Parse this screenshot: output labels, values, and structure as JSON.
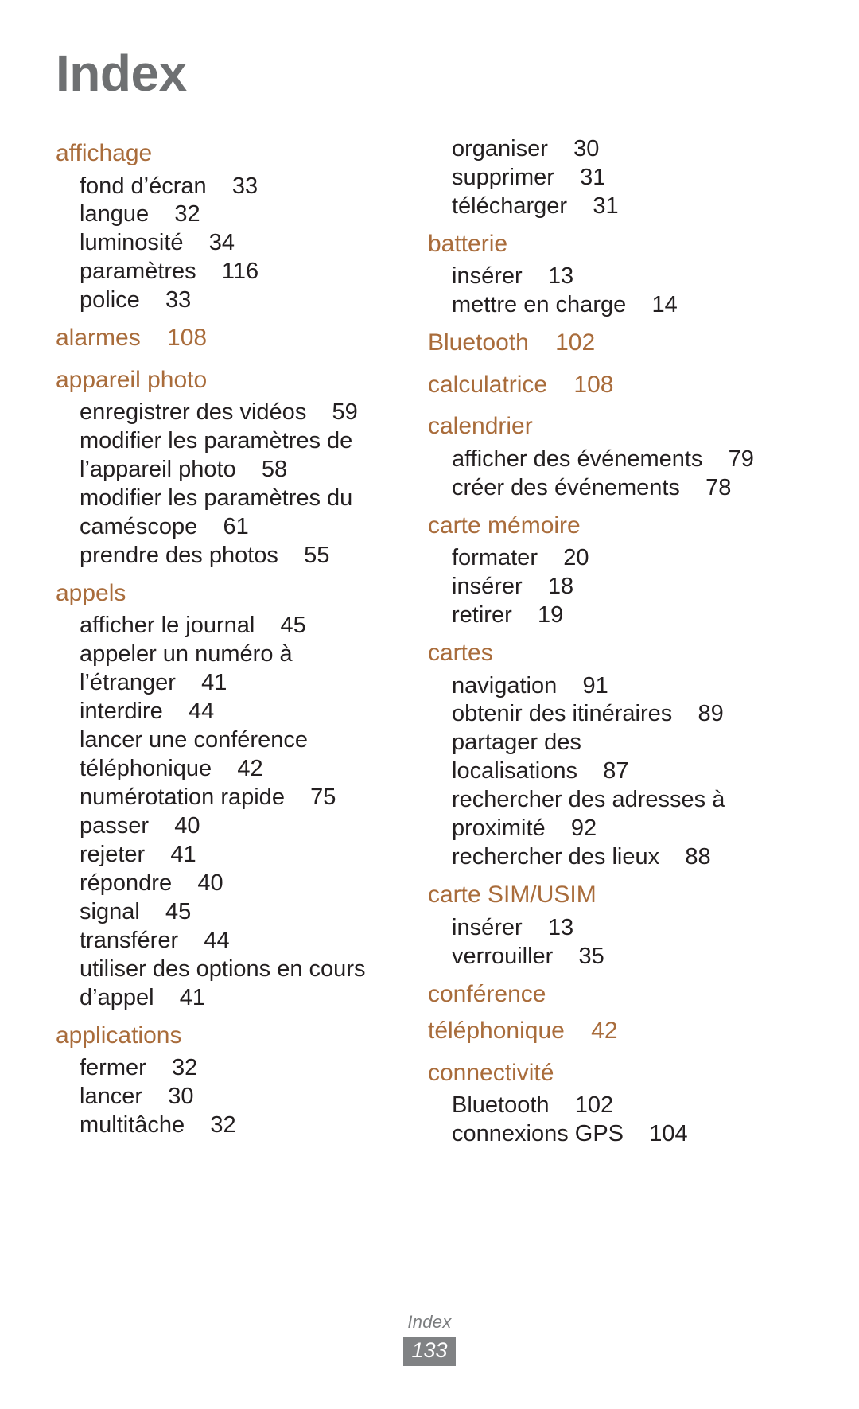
{
  "page_title": "Index",
  "footer": {
    "label": "Index",
    "page_number": "133"
  },
  "colors": {
    "heading": "#a96c3b",
    "entry": "#231f20",
    "title": "#6e7072",
    "footer_box": "#808284"
  },
  "columns": [
    {
      "groups": [
        {
          "heading": "affichage",
          "heading_page": "",
          "entries": [
            "fond d’écran    33",
            "langue    32",
            "luminosité    34",
            "paramètres    116",
            "police    33"
          ]
        },
        {
          "heading": "alarmes",
          "heading_page": "108",
          "entries": []
        },
        {
          "heading": "appareil photo",
          "heading_page": "",
          "entries": [
            "enregistrer des vidéos    59",
            "modifier les paramètres de\nl’appareil photo    58",
            "modifier les paramètres du\ncaméscope    61",
            "prendre des photos    55"
          ]
        },
        {
          "heading": "appels",
          "heading_page": "",
          "entries": [
            "afficher le journal    45",
            "appeler un numéro à\nl’étranger    41",
            "interdire    44",
            "lancer une conférence\ntéléphonique    42",
            "numérotation rapide    75",
            "passer    40",
            "rejeter    41",
            "répondre    40",
            "signal    45",
            "transférer    44",
            "utiliser des options en cours\nd’appel    41"
          ]
        },
        {
          "heading": "applications",
          "heading_page": "",
          "entries": [
            "fermer    32",
            "lancer    30",
            "multitâche    32"
          ]
        }
      ]
    },
    {
      "groups": [
        {
          "heading": "",
          "heading_page": "",
          "entries": [
            "organiser    30",
            "supprimer    31",
            "télécharger    31"
          ]
        },
        {
          "heading": "batterie",
          "heading_page": "",
          "entries": [
            "insérer    13",
            "mettre en charge    14"
          ]
        },
        {
          "heading": "Bluetooth",
          "heading_page": "102",
          "entries": []
        },
        {
          "heading": "calculatrice",
          "heading_page": "108",
          "entries": []
        },
        {
          "heading": "calendrier",
          "heading_page": "",
          "entries": [
            "afficher des événements    79",
            "créer des événements    78"
          ]
        },
        {
          "heading": "carte mémoire",
          "heading_page": "",
          "entries": [
            "formater    20",
            "insérer    18",
            "retirer    19"
          ]
        },
        {
          "heading": "cartes",
          "heading_page": "",
          "entries": [
            "navigation    91",
            "obtenir des itinéraires    89",
            "partager des\nlocalisations    87",
            "rechercher des adresses à\nproximité    92",
            "rechercher des lieux    88"
          ]
        },
        {
          "heading": "carte SIM/USIM",
          "heading_page": "",
          "entries": [
            "insérer    13",
            "verrouiller    35"
          ]
        },
        {
          "heading": "conférence\ntéléphonique",
          "heading_page": "42",
          "entries": []
        },
        {
          "heading": "connectivité",
          "heading_page": "",
          "entries": [
            "Bluetooth    102",
            "connexions GPS    104"
          ]
        }
      ]
    }
  ]
}
